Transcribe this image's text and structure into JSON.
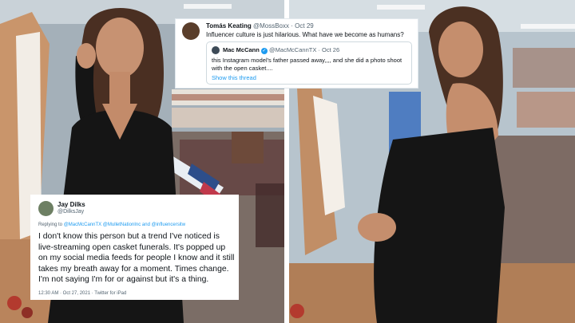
{
  "top_tweet": {
    "author_name": "Tomás Keating",
    "author_handle": "@MossBoxx",
    "date": "Oct 29",
    "text": "Influencer culture is just hilarious. What have we become as humans?",
    "quoted": {
      "author_name": "Mac McCann",
      "author_handle": "@MacMcCannTX",
      "date": "Oct 26",
      "verified": true,
      "text": "this Instagram model's father passed away,,,, and she did a photo shoot with the open casket....",
      "show_thread": "Show this thread"
    }
  },
  "bottom_tweet": {
    "author_name": "Jay Dilks",
    "author_handle": "@DilksJay",
    "replying_prefix": "Replying to",
    "replying_to": "@MacMcCannTX @MulletNationInc and @influencersitw",
    "text": "I don't know this person but a trend I've noticed is live-streaming open casket funerals. It's popped up on my social media feeds for people I know and it still takes my breath away for a moment. Times change. I'm not saying I'm for or against but it's a thing.",
    "timestamp": "12:30 AM · Oct 27, 2021 · Twitter for iPad"
  },
  "colors": {
    "link": "#1d9bf0",
    "dress": "#151515",
    "casket_wood": "#c89a72"
  }
}
